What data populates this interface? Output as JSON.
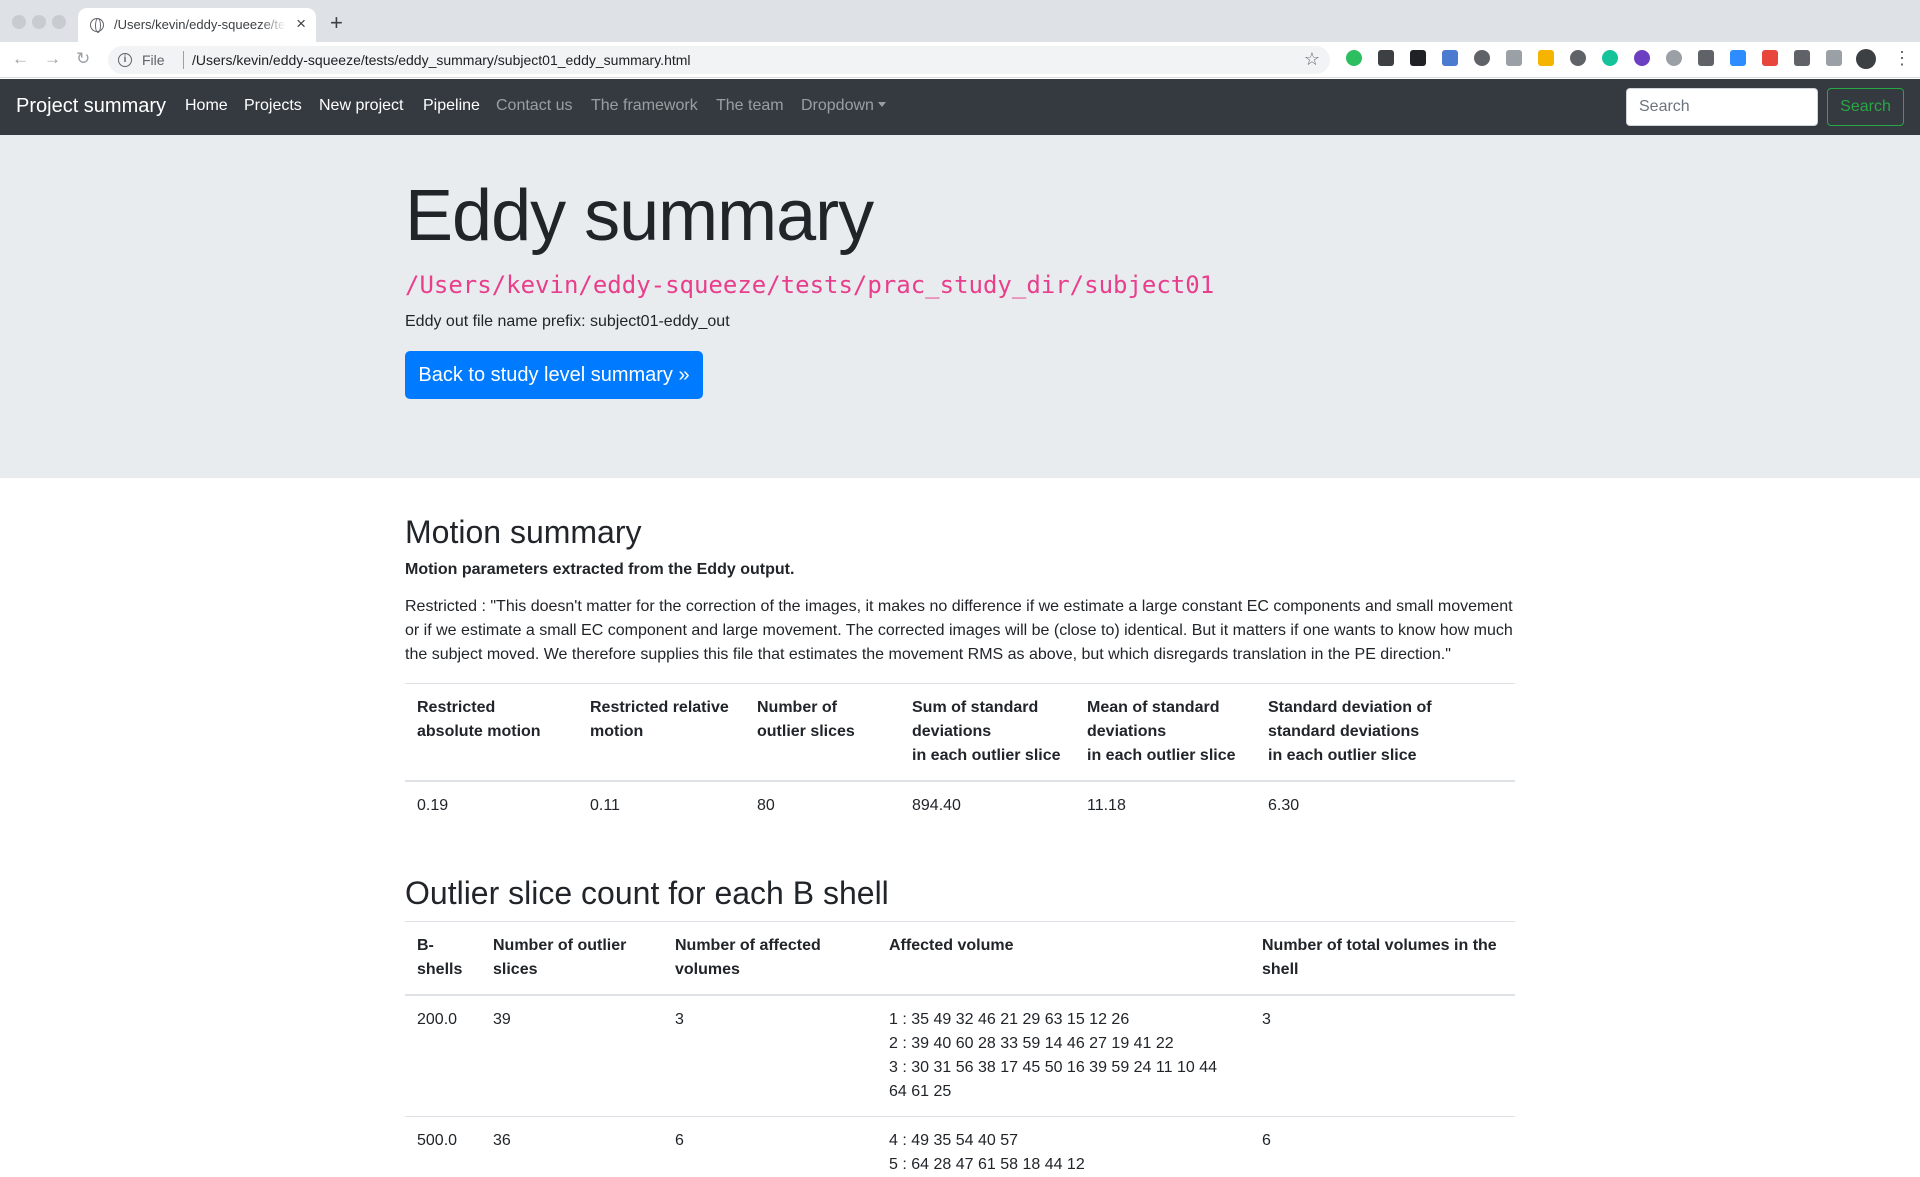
{
  "browser": {
    "tab_title": "/Users/kevin/eddy-squeeze/tests/eddy_summary/subject01_eddy_summary.html",
    "tab_close": "×",
    "new_tab": "+",
    "scheme": "File",
    "url": "/Users/kevin/eddy-squeeze/tests/eddy_summary/subject01_eddy_summary.html",
    "icons": [
      "back-icon",
      "forward-icon",
      "reload-icon",
      "info-icon",
      "bookmark-star-icon",
      "extensions-icon",
      "profile-avatar",
      "menu-kebab-icon"
    ]
  },
  "navbar": {
    "brand": "Project summary",
    "links": [
      "Home",
      "Projects",
      "New project",
      "Pipeline",
      "Contact us",
      "The framework",
      "The team",
      "Dropdown"
    ],
    "search_placeholder": "Search",
    "search_button": "Search",
    "accent": "#343a40",
    "search_color": "#28a745"
  },
  "jumbotron": {
    "title": "Eddy summary",
    "path": "/Users/kevin/eddy-squeeze/tests/prac_study_dir/subject01",
    "prefix_text": "Eddy out file name prefix: subject01-eddy_out",
    "back_button": "Back to study level summary »",
    "button_color": "#007bff"
  },
  "motion": {
    "title": "Motion summary",
    "subtitle": "Motion parameters extracted from the Eddy output.",
    "description": "Restricted : \"This doesn't matter for the correction of the images, it makes no difference if we estimate a large constant EC components and small movement or if we estimate a small EC component and large movement. The corrected images will be (close to) identical. But it matters if one wants to know how much the subject moved. We therefore supplies this file that estimates the movement RMS as above, but which disregards translation in the PE direction.\"",
    "headers": [
      [
        "Restricted",
        "absolute motion"
      ],
      [
        "Restricted relative",
        "motion"
      ],
      [
        "Number of",
        "outlier slices"
      ],
      [
        "Sum of standard",
        "deviations",
        "in each outlier slice"
      ],
      [
        "Mean of standard",
        "deviations",
        "in each outlier slice"
      ],
      [
        "Standard deviation of",
        "standard deviations",
        "in each outlier slice"
      ]
    ],
    "values": [
      "0.19",
      "0.11",
      "80",
      "894.40",
      "11.18",
      "6.30"
    ]
  },
  "outliers": {
    "title": "Outlier slice count for each B shell",
    "headers": [
      "B-shells",
      "Number of outlier slices",
      "Number of affected volumes",
      "Affected volume",
      "Number of total volumes in the shell"
    ],
    "rows": [
      {
        "bshell": "200.0",
        "outlier_slices": "39",
        "affected_volumes": "3",
        "affected_volume_lines": [
          "1 : 35 49 32 46 21 29 63 15 12 26",
          "2 : 39 40 60 28 33 59 14 46 27 19 41 22",
          "3 : 30 31 56 38 17 45 50 16 39 59 24 11 10 44 64 61 25"
        ],
        "total_volumes": "3"
      },
      {
        "bshell": "500.0",
        "outlier_slices": "36",
        "affected_volumes": "6",
        "affected_volume_lines": [
          "4 : 49 35 54 40 57",
          "5 : 64 28 47 61 58 18 44 12"
        ],
        "total_volumes": "6"
      }
    ]
  }
}
